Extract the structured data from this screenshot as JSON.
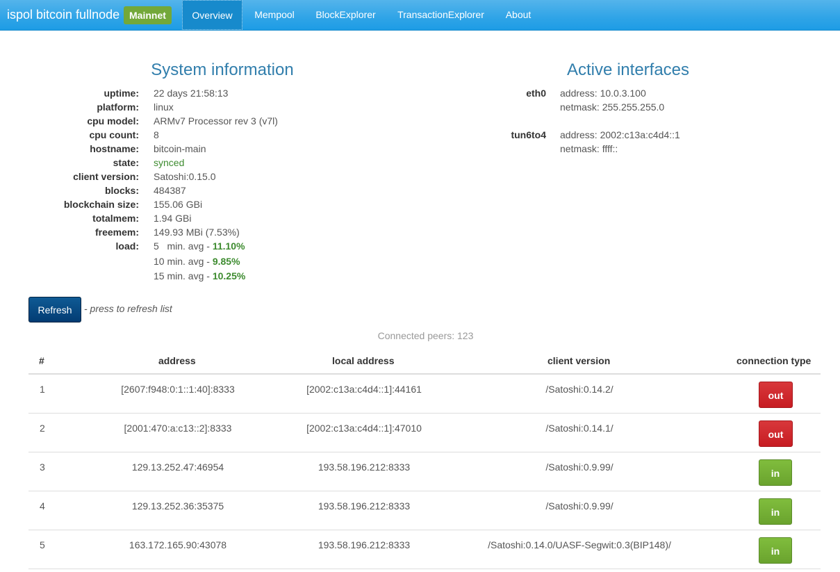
{
  "navbar": {
    "brand": "ispol bitcoin fullnode",
    "network_badge": "Mainnet",
    "items": [
      {
        "label": "Overview",
        "active": true
      },
      {
        "label": "Mempool",
        "active": false
      },
      {
        "label": "BlockExplorer",
        "active": false
      },
      {
        "label": "TransactionExplorer",
        "active": false
      },
      {
        "label": "About",
        "active": false
      }
    ]
  },
  "system_info": {
    "title": "System information",
    "rows": [
      {
        "key": "uptime:",
        "value": "22 days 21:58:13"
      },
      {
        "key": "platform:",
        "value": "linux"
      },
      {
        "key": "cpu model:",
        "value": "ARMv7 Processor rev 3 (v7l)"
      },
      {
        "key": "cpu count:",
        "value": "8"
      },
      {
        "key": "hostname:",
        "value": "bitcoin-main"
      },
      {
        "key": "state:",
        "value": "synced"
      },
      {
        "key": "client version:",
        "value": "Satoshi:0.15.0"
      },
      {
        "key": "blocks:",
        "value": "484387"
      },
      {
        "key": "blockchain size:",
        "value": "155.06 GBi"
      },
      {
        "key": "totalmem:",
        "value": "1.94 GBi"
      },
      {
        "key": "freemem:",
        "value": "149.93 MBi (7.53%)"
      }
    ],
    "load": {
      "key": "load:",
      "entries": [
        {
          "label": "5   min. avg - ",
          "value": "11.10%"
        },
        {
          "label": "10 min. avg - ",
          "value": "9.85%"
        },
        {
          "label": "15 min. avg - ",
          "value": "10.25%"
        }
      ]
    }
  },
  "interfaces": {
    "title": "Active interfaces",
    "items": [
      {
        "name": "eth0",
        "address": "address: 10.0.3.100",
        "netmask": "netmask: 255.255.255.0"
      },
      {
        "name": "tun6to4",
        "address": "address: 2002:c13a:c4d4::1",
        "netmask": "netmask: ffff::"
      }
    ]
  },
  "refresh": {
    "button_label": "Refresh",
    "hint": "- press to refresh list"
  },
  "peers": {
    "summary": "Connected peers: 123",
    "columns": [
      "#",
      "address",
      "local address",
      "client version",
      "connection type"
    ],
    "rows": [
      {
        "n": "1",
        "address": "[2607:f948:0:1::1:40]:8333",
        "local": "[2002:c13a:c4d4::1]:44161",
        "client": "/Satoshi:0.14.2/",
        "type": "out"
      },
      {
        "n": "2",
        "address": "[2001:470:a:c13::2]:8333",
        "local": "[2002:c13a:c4d4::1]:47010",
        "client": "/Satoshi:0.14.1/",
        "type": "out"
      },
      {
        "n": "3",
        "address": "129.13.252.47:46954",
        "local": "193.58.196.212:8333",
        "client": "/Satoshi:0.9.99/",
        "type": "in"
      },
      {
        "n": "4",
        "address": "129.13.252.36:35375",
        "local": "193.58.196.212:8333",
        "client": "/Satoshi:0.9.99/",
        "type": "in"
      },
      {
        "n": "5",
        "address": "163.172.165.90:43078",
        "local": "193.58.196.212:8333",
        "client": "/Satoshi:0.14.0/UASF-Segwit:0.3(BIP148)/",
        "type": "in"
      }
    ]
  },
  "colors": {
    "navbar": "#2fa4e7",
    "heading": "#317eac",
    "badge": "#73a839",
    "out_button": "#c71c22",
    "in_button": "#73a839",
    "refresh_button": "#033c73",
    "synced": "#3d8b2f"
  }
}
